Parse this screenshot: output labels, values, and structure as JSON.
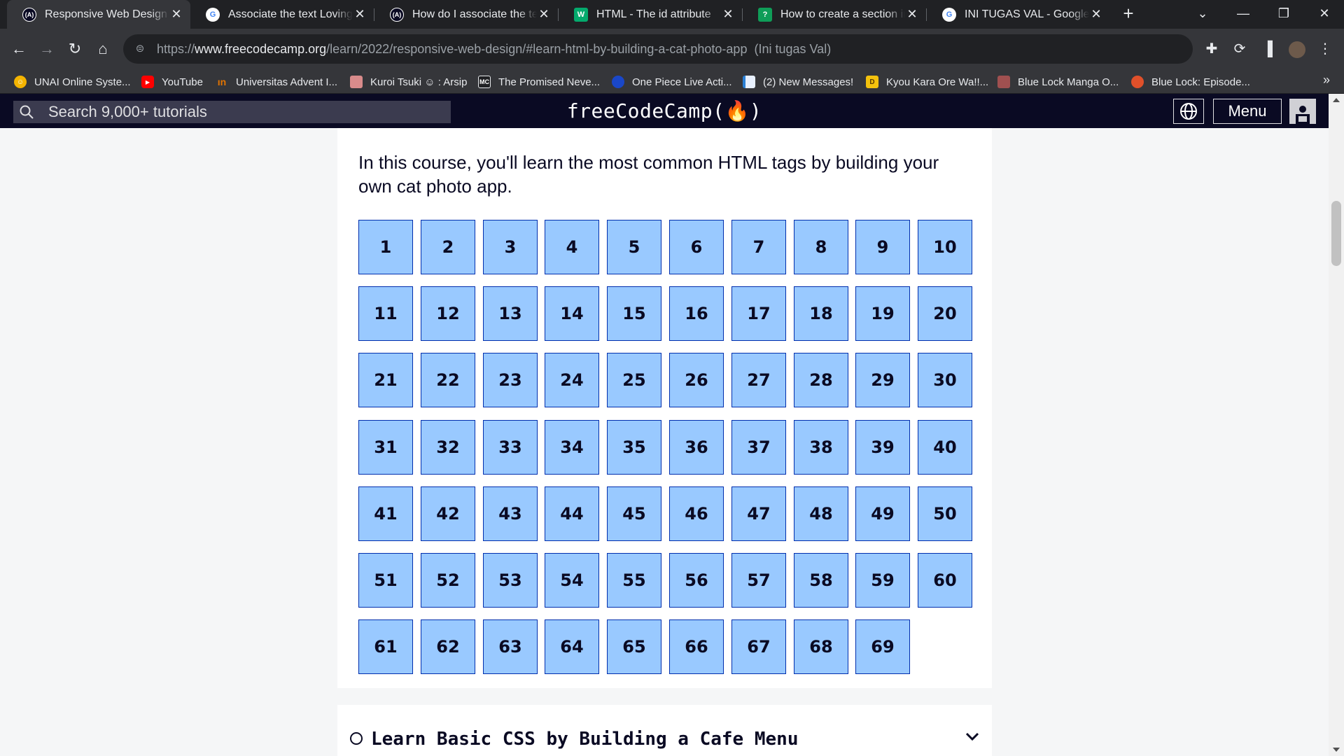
{
  "browser": {
    "tabs": [
      {
        "title": "Responsive Web Design Certification",
        "icon": "fcc-icon",
        "active": true
      },
      {
        "title": "Associate the text Loving with",
        "icon": "google-icon",
        "active": false
      },
      {
        "title": "How do I associate the text",
        "icon": "fcc-icon",
        "active": false
      },
      {
        "title": "HTML - The id attribute",
        "icon": "w3schools-icon",
        "active": false
      },
      {
        "title": "How to create a section in",
        "icon": "doc-icon",
        "active": false
      },
      {
        "title": "INI TUGAS VAL - Google Search",
        "icon": "google-icon",
        "active": false
      }
    ],
    "url": {
      "scheme": "https://",
      "host": "www.freecodecamp.org",
      "path": "/learn/2022/responsive-web-design/#learn-html-by-building-a-cat-photo-app",
      "profile_tag": "(Ini tugas Val)"
    },
    "bookmarks": [
      {
        "label": "UNAI Online Syste...",
        "icon": "unai-icon",
        "color": "#f4b400"
      },
      {
        "label": "YouTube",
        "icon": "youtube-icon",
        "color": "#ff0000"
      },
      {
        "label": "Universitas Advent I...",
        "icon": "unai-logo-icon",
        "color": "#e37400"
      },
      {
        "label": "Kuroi Tsuki ☺ : Arsip",
        "icon": "kuroi-tsuki-icon",
        "color": "#d88b8b"
      },
      {
        "label": "The Promised Neve...",
        "icon": "mc-icon",
        "color": "#202124"
      },
      {
        "label": "One Piece Live Acti...",
        "icon": "one-piece-icon",
        "color": "#1a47c8"
      },
      {
        "label": "(2) New Messages!",
        "icon": "messages-icon",
        "color": "#2a7fd4"
      },
      {
        "label": "Kyou Kara Ore Wa!!...",
        "icon": "kyou-kara-icon",
        "color": "#f4c20d"
      },
      {
        "label": "Blue Lock Manga O...",
        "icon": "blue-lock-icon",
        "color": "#a05050"
      },
      {
        "label": "Blue Lock: Episode...",
        "icon": "blue-lock-episode-icon",
        "color": "#e0502a"
      }
    ],
    "more_bookmarks": "»"
  },
  "fcc": {
    "search_placeholder": "Search 9,000+ tutorials",
    "brand": "freeCodeCamp(🔥)",
    "brand_text": "freeCodeCamp",
    "menu_label": "Menu",
    "intro": "In this course, you'll learn the most common HTML tags by building your own cat photo app.",
    "steps": [
      "1",
      "2",
      "3",
      "4",
      "5",
      "6",
      "7",
      "8",
      "9",
      "10",
      "11",
      "12",
      "13",
      "14",
      "15",
      "16",
      "17",
      "18",
      "19",
      "20",
      "21",
      "22",
      "23",
      "24",
      "25",
      "26",
      "27",
      "28",
      "29",
      "30",
      "31",
      "32",
      "33",
      "34",
      "35",
      "36",
      "37",
      "38",
      "39",
      "40",
      "41",
      "42",
      "43",
      "44",
      "45",
      "46",
      "47",
      "48",
      "49",
      "50",
      "51",
      "52",
      "53",
      "54",
      "55",
      "56",
      "57",
      "58",
      "59",
      "60",
      "61",
      "62",
      "63",
      "64",
      "65",
      "66",
      "67",
      "68",
      "69"
    ],
    "next_block": "Learn Basic CSS by Building a Cafe Menu"
  },
  "colors": {
    "step_bg": "#99c9ff",
    "step_border": "#002ead",
    "nav_bg": "#0a0a23"
  }
}
